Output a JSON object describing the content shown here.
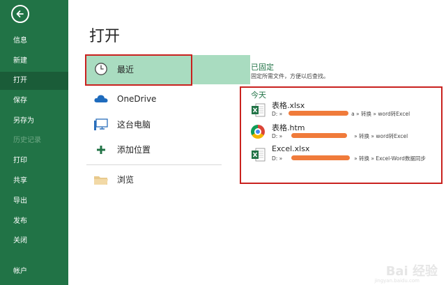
{
  "sidebar": {
    "items": [
      {
        "label": "信息",
        "state": "normal"
      },
      {
        "label": "新建",
        "state": "normal"
      },
      {
        "label": "打开",
        "state": "active"
      },
      {
        "label": "保存",
        "state": "normal"
      },
      {
        "label": "另存为",
        "state": "normal"
      },
      {
        "label": "历史记录",
        "state": "disabled"
      },
      {
        "label": "打印",
        "state": "normal"
      },
      {
        "label": "共享",
        "state": "normal"
      },
      {
        "label": "导出",
        "state": "normal"
      },
      {
        "label": "发布",
        "state": "normal"
      },
      {
        "label": "关闭",
        "state": "normal"
      },
      {
        "label": "帐户",
        "state": "normal"
      }
    ],
    "back_icon": "back-arrow-icon"
  },
  "main": {
    "title": "打开",
    "locations": [
      {
        "label": "最近",
        "icon": "clock-icon"
      },
      {
        "label": "OneDrive",
        "icon": "cloud-icon"
      },
      {
        "label": "这台电脑",
        "icon": "computer-icon"
      },
      {
        "label": "添加位置",
        "icon": "plus-icon"
      },
      {
        "label": "浏览",
        "icon": "folder-icon"
      }
    ],
    "pinned": {
      "title": "已固定",
      "description": "固定所需文件，方便以后查找。"
    },
    "today_label": "今天",
    "files": [
      {
        "name": "表格.xlsx",
        "path_prefix": "D: »",
        "path_suffix": "a » 转换 » word转Excel",
        "icon": "excel-file-icon"
      },
      {
        "name": "表格.htm",
        "path_prefix": "D: »",
        "path_suffix": "» 转换 » word转Excel",
        "icon": "chrome-icon"
      },
      {
        "name": "Excel.xlsx",
        "path_prefix": "D: »",
        "path_suffix": "» 转换 » Excel-Word数据同步",
        "icon": "excel-file-icon"
      }
    ]
  },
  "watermark": {
    "text": "Bai 经验",
    "sub": "jingyan.baidu.com"
  },
  "colors": {
    "accent": "#217346",
    "sidebar_active": "#1a5c38",
    "highlight": "#c9211e",
    "selected_location": "#a9dcc0",
    "redaction": "#f07b3b"
  }
}
